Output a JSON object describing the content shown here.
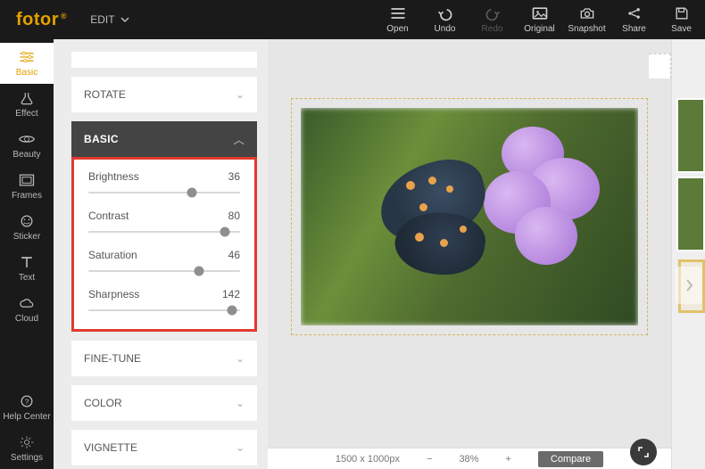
{
  "logo": "fotor",
  "mode": {
    "label": "EDIT"
  },
  "topActions": {
    "open": "Open",
    "undo": "Undo",
    "redo": "Redo",
    "original": "Original",
    "snapshot": "Snapshot",
    "share": "Share",
    "save": "Save"
  },
  "rail": {
    "basic": "Basic",
    "effect": "Effect",
    "beauty": "Beauty",
    "frames": "Frames",
    "sticker": "Sticker",
    "text": "Text",
    "cloud": "Cloud",
    "helpCenter": "Help Center",
    "settings": "Settings"
  },
  "panel": {
    "rotate": "ROTATE",
    "basic": "BASIC",
    "fineTune": "FINE-TUNE",
    "color": "COLOR",
    "vignette": "VIGNETTE"
  },
  "sliders": {
    "brightness": {
      "label": "Brightness",
      "value": 36,
      "min": -100,
      "max": 100
    },
    "contrast": {
      "label": "Contrast",
      "value": 80,
      "min": -100,
      "max": 100
    },
    "saturation": {
      "label": "Saturation",
      "value": 46,
      "min": -100,
      "max": 100
    },
    "sharpness": {
      "label": "Sharpness",
      "value": 142,
      "min": 0,
      "max": 150
    }
  },
  "bottom": {
    "dims": "1500 x 1000px",
    "zoom": "38%",
    "compare": "Compare"
  }
}
